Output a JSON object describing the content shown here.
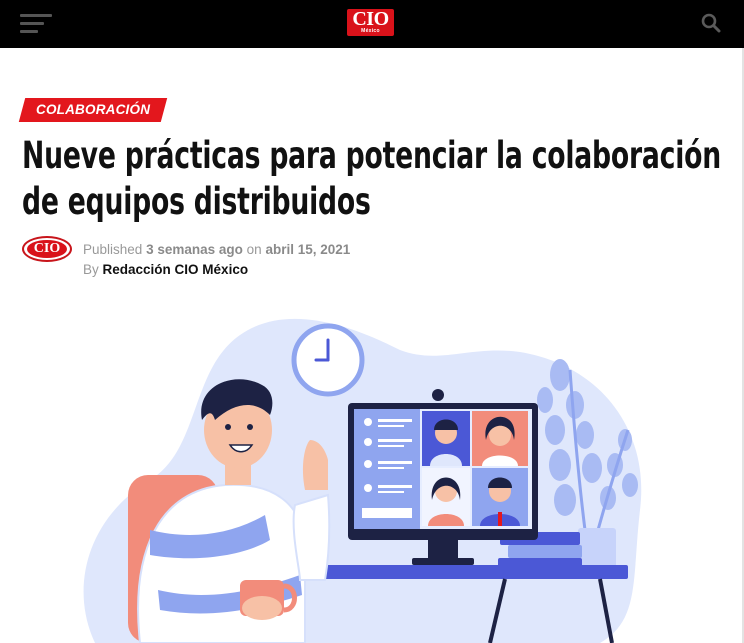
{
  "header": {
    "logo_text": "CIO",
    "logo_subtext": "México",
    "menu_icon": "hamburger-menu-icon",
    "search_icon": "search-icon"
  },
  "article": {
    "category": "COLABORACIÓN",
    "title": "Nueve prácticas para potenciar la colaboración de equipos distribuidos",
    "published_label": "Published",
    "relative_time": "3 semanas ago",
    "on_label": "on",
    "date": "abril 15, 2021",
    "by_label": "By",
    "author": "Redacción CIO México",
    "avatar_text": "CIO"
  },
  "colors": {
    "topbar": "#000000",
    "accent": "#e3171d",
    "illustration_blue": "#d6e0fb",
    "illustration_indigo": "#4b58d6"
  }
}
